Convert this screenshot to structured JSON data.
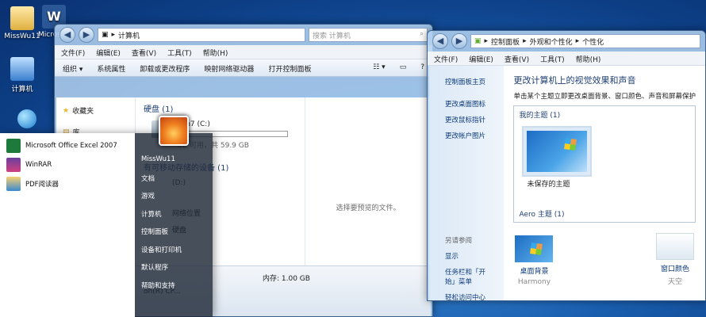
{
  "desktop": {
    "icons": [
      {
        "label": "MissWu11"
      },
      {
        "label": "Microsoft Office Word"
      },
      {
        "label": "计算机"
      }
    ]
  },
  "explorer": {
    "address": {
      "seg1": "计算机",
      "arrow": "▸"
    },
    "search_placeholder": "搜索 计算机",
    "menu": [
      "文件(F)",
      "编辑(E)",
      "查看(V)",
      "工具(T)",
      "帮助(H)"
    ],
    "toolbar": [
      "组织 ▾",
      "系统属性",
      "卸载或更改程序",
      "映射网络驱动器",
      "打开控制面板"
    ],
    "nav": {
      "favorites": "收藏夹",
      "library": "库"
    },
    "groups": {
      "hard_disk": "硬盘 (1)",
      "removable": "有可移动存储的设备 (1)"
    },
    "drive": {
      "name": "Win7 (C:)",
      "space": "GB 可用，共 59.9 GB",
      "used_fraction": 0.05
    },
    "drive2": {
      "name": "(D:)"
    },
    "misc_items": [
      "网络位置",
      "硬盘"
    ],
    "preview_text": "选择要预览的文件。",
    "details": {
      "memory": "内存: 1.00 GB",
      "processor": "on(R) CP..."
    }
  },
  "cpanel": {
    "address": {
      "seg1": "控制面板",
      "seg2": "外观和个性化",
      "seg3": "个性化",
      "sep": "▸"
    },
    "menu": [
      "文件(F)",
      "编辑(E)",
      "查看(V)",
      "工具(T)",
      "帮助(H)"
    ],
    "side": {
      "home": "控制面板主页",
      "items": [
        "更改桌面图标",
        "更改鼠标指针",
        "更改帐户图片"
      ],
      "see_also": "另请参阅",
      "see_items": [
        "显示",
        "任务栏和「开始」菜单",
        "轻松访问中心"
      ]
    },
    "title": "更改计算机上的视觉效果和声音",
    "subtitle": "单击某个主题立即更改桌面背景、窗口颜色、声音和屏幕保护",
    "my_themes": "我的主题 (1)",
    "unsaved": "未保存的主题",
    "aero": "Aero 主题 (1)",
    "tiles": [
      {
        "label": "桌面背景",
        "sub": "Harmony"
      },
      {
        "label": "窗口颜色",
        "sub": "天空"
      }
    ]
  },
  "startmenu": {
    "programs": [
      "Microsoft Office Excel 2007",
      "WinRAR",
      "PDF阅读器"
    ],
    "right": [
      "MissWu11",
      "文档",
      "游戏",
      "计算机",
      "控制面板",
      "设备和打印机",
      "默认程序",
      "帮助和支持"
    ]
  },
  "colors": {
    "accent": "#1e3f74",
    "desktop": "#1a5fb0"
  }
}
